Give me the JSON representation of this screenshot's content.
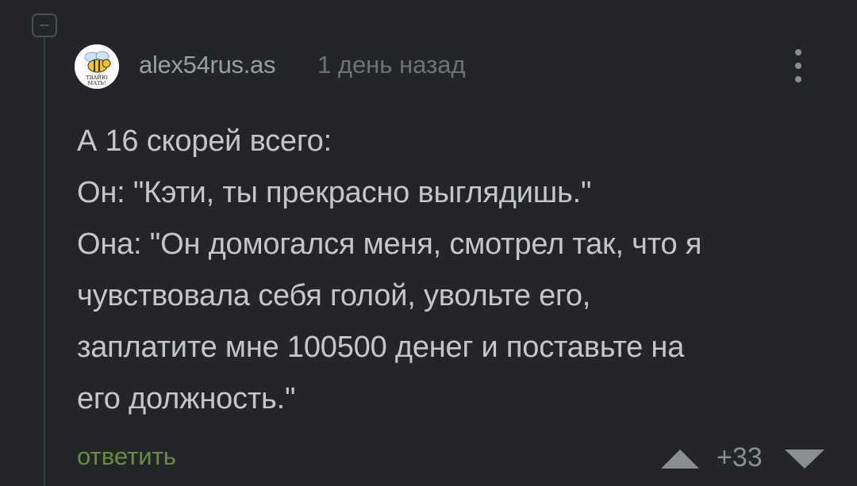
{
  "comment": {
    "author": "alex54rus.as",
    "timestamp": "1 день назад",
    "avatar_caption_top": "ТВАЙЮ",
    "avatar_caption_bottom": "МАТЬ!",
    "body_lines": [
      "А 16 скорей всего:",
      "Он: \"Кэти, ты прекрасно выглядишь.\"",
      "Она: \"Он домогался меня, смотрел так, что я",
      "чувствовала себя голой, увольте его,",
      "заплатите мне 100500 денег и поставьте на",
      "его должность.\""
    ],
    "reply_label": "ответить",
    "score": "+33"
  },
  "icons": {
    "collapse": "minus-square-icon",
    "more": "vertical-dots-icon",
    "upvote": "triangle-up-icon",
    "downvote": "triangle-down-icon"
  },
  "colors": {
    "background": "#232528",
    "text": "#c4c6c8",
    "meta": "#9a9da1",
    "reply": "#6a8c44",
    "icon": "#8a8d91"
  }
}
